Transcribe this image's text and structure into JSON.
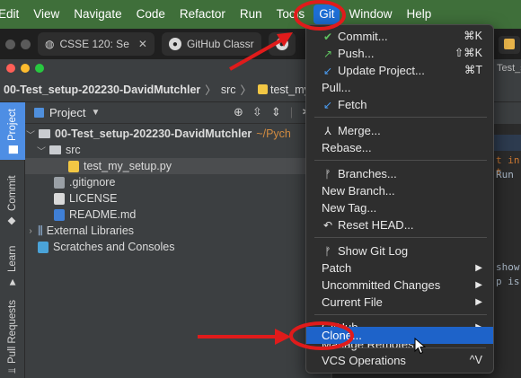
{
  "menubar": {
    "items": [
      "Edit",
      "View",
      "Navigate",
      "Code",
      "Refactor",
      "Run",
      "Tools",
      "Git",
      "Window",
      "Help"
    ]
  },
  "browser": {
    "tabs": [
      {
        "title": "CSSE 120: Se",
        "icon": "globe-icon"
      },
      {
        "title": "GitHub Classr",
        "icon": "github-icon"
      }
    ]
  },
  "ide": {
    "breadcrumb": {
      "project": "00-Test_setup-202230-DavidMutchler",
      "folder": "src",
      "file": "test_my_s"
    },
    "sidebar_tabs": [
      "Project",
      "Commit",
      "Learn",
      "Pull Requests"
    ],
    "panel_title": "Project",
    "tree": [
      {
        "label": "00-Test_setup-202230-DavidMutchler",
        "suffix": "~/Pych",
        "type": "folder",
        "level": 0,
        "expanded": true
      },
      {
        "label": "src",
        "type": "folder",
        "level": 1,
        "expanded": true
      },
      {
        "label": "test_my_setup.py",
        "type": "python",
        "level": 2,
        "selected": true
      },
      {
        "label": ".gitignore",
        "type": "gitignore",
        "level": 1
      },
      {
        "label": "LICENSE",
        "type": "text",
        "level": 1
      },
      {
        "label": "README.md",
        "type": "markdown",
        "level": 1
      },
      {
        "label": "External Libraries",
        "type": "library",
        "level": 0,
        "expanded": false
      },
      {
        "label": "Scratches and Consoles",
        "type": "scratch",
        "level": 0
      }
    ],
    "editor_fragments": [
      "t in t",
      "Run",
      "show",
      "p is"
    ],
    "right_fragment": "Test_s"
  },
  "git_menu": {
    "items": [
      {
        "label": "Commit...",
        "shortcut": "⌘K",
        "icon": "check-icon"
      },
      {
        "label": "Push...",
        "shortcut": "⇧⌘K",
        "icon": "push-arrow-icon"
      },
      {
        "label": "Update Project...",
        "shortcut": "⌘T",
        "icon": "update-arrow-icon"
      },
      {
        "label": "Pull..."
      },
      {
        "label": "Fetch",
        "icon": "fetch-icon"
      },
      {
        "label": "Merge...",
        "icon": "merge-icon"
      },
      {
        "label": "Rebase..."
      },
      {
        "label": "Branches...",
        "icon": "branch-icon"
      },
      {
        "label": "New Branch..."
      },
      {
        "label": "New Tag..."
      },
      {
        "label": "Reset HEAD...",
        "icon": "reset-icon"
      },
      {
        "label": "Show Git Log",
        "icon": "branch-icon"
      },
      {
        "label": "Patch",
        "submenu": true
      },
      {
        "label": "Uncommitted Changes",
        "submenu": true
      },
      {
        "label": "Current File",
        "submenu": true
      },
      {
        "label": "GitHub",
        "submenu": true
      },
      {
        "label": "Manage Remotes..."
      },
      {
        "label": "Clone...",
        "highlighted": true
      },
      {
        "label": "VCS Operations",
        "shortcut": "^V"
      }
    ]
  },
  "colors": {
    "menubar_bg": "#3f6f3a",
    "menu_highlight": "#1e63c9",
    "annotation_red": "#e01b1b"
  }
}
